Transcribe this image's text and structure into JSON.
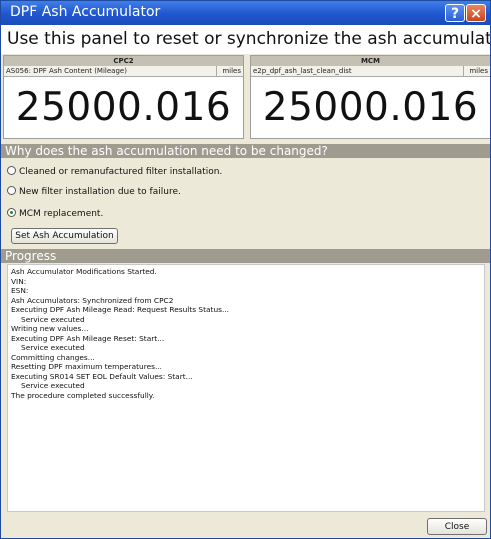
{
  "window": {
    "title": "DPF Ash Accumulator",
    "help_icon": "?",
    "close_icon": "×",
    "accent_color": "#1f56cf"
  },
  "instruction": "Use this panel to reset or synchronize the ash accumulators.",
  "panels": [
    {
      "header": "CPC2",
      "param_name": "AS056: DPF Ash Content (Mileage)",
      "unit": "miles",
      "value": "25000.016"
    },
    {
      "header": "MCM",
      "param_name": "e2p_dpf_ash_last_clean_dist",
      "unit": "miles",
      "value": "25000.016"
    }
  ],
  "question": {
    "title": "Why does the ash accumulation need to be changed?"
  },
  "options": [
    {
      "label": "Cleaned or remanufactured filter installation.",
      "selected": false
    },
    {
      "label": "New filter installation due to failure.",
      "selected": false
    },
    {
      "label": "MCM replacement.",
      "selected": true
    }
  ],
  "set_button_label": "Set Ash Accumulation",
  "progress": {
    "title": "Progress",
    "log": [
      {
        "text": "Ash Accumulator Modifications Started.",
        "indent": false
      },
      {
        "text": "VIN:",
        "indent": false
      },
      {
        "text": "ESN:",
        "indent": false
      },
      {
        "text": "Ash Accumulators: Synchronized from CPC2",
        "indent": false
      },
      {
        "text": "Executing DPF Ash Mileage Read: Request Results Status...",
        "indent": false
      },
      {
        "text": "Service executed",
        "indent": true
      },
      {
        "text": "Writing new values...",
        "indent": false
      },
      {
        "text": "Executing DPF Ash Mileage Reset: Start...",
        "indent": false
      },
      {
        "text": "Service executed",
        "indent": true
      },
      {
        "text": "Committing changes...",
        "indent": false
      },
      {
        "text": "Resetting DPF maximum temperatures...",
        "indent": false
      },
      {
        "text": "Executing SR014 SET EOL Default Values: Start...",
        "indent": false
      },
      {
        "text": "Service executed",
        "indent": true
      },
      {
        "text": "The procedure completed successfully.",
        "indent": false
      }
    ]
  },
  "close_button_label": "Close"
}
